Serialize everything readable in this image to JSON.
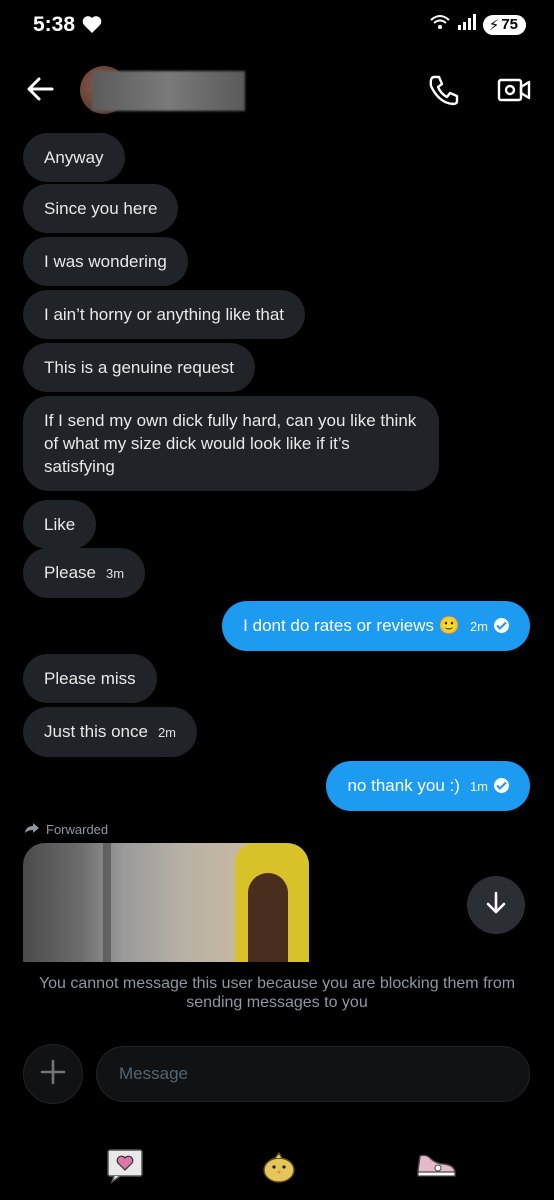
{
  "status_bar": {
    "time": "5:38",
    "battery": "75"
  },
  "header": {
    "avatar_icon": "avatar",
    "call_icon": "phone-icon",
    "video_icon": "video-icon"
  },
  "messages": [
    {
      "dir": "in",
      "text": "Anyway"
    },
    {
      "dir": "in",
      "text": "Since you here"
    },
    {
      "dir": "in",
      "text": "I was wondering"
    },
    {
      "dir": "in",
      "text": "I ain’t horny or anything like that"
    },
    {
      "dir": "in",
      "text": "This is a genuine request"
    },
    {
      "dir": "in",
      "text": "If I send my own dick fully hard, can you like think of what my size dick would look like if it’s satisfying"
    },
    {
      "dir": "in",
      "text": "Like"
    },
    {
      "dir": "in",
      "text": "Please",
      "time": "3m"
    },
    {
      "dir": "out",
      "text": "I dont do rates or reviews 🙂",
      "time": "2m"
    },
    {
      "dir": "in",
      "text": "Please miss"
    },
    {
      "dir": "in",
      "text": "Just this once",
      "time": "2m"
    },
    {
      "dir": "out",
      "text": "no thank you :)",
      "time": "1m"
    }
  ],
  "forwarded_label": "Forwarded",
  "blocked_note": "You cannot message this user because you are blocking them from sending messages to you",
  "composer": {
    "placeholder": "Message"
  },
  "colors": {
    "incoming_bubble": "#202327",
    "outgoing_bubble": "#1d9bf0",
    "background": "#000000"
  }
}
